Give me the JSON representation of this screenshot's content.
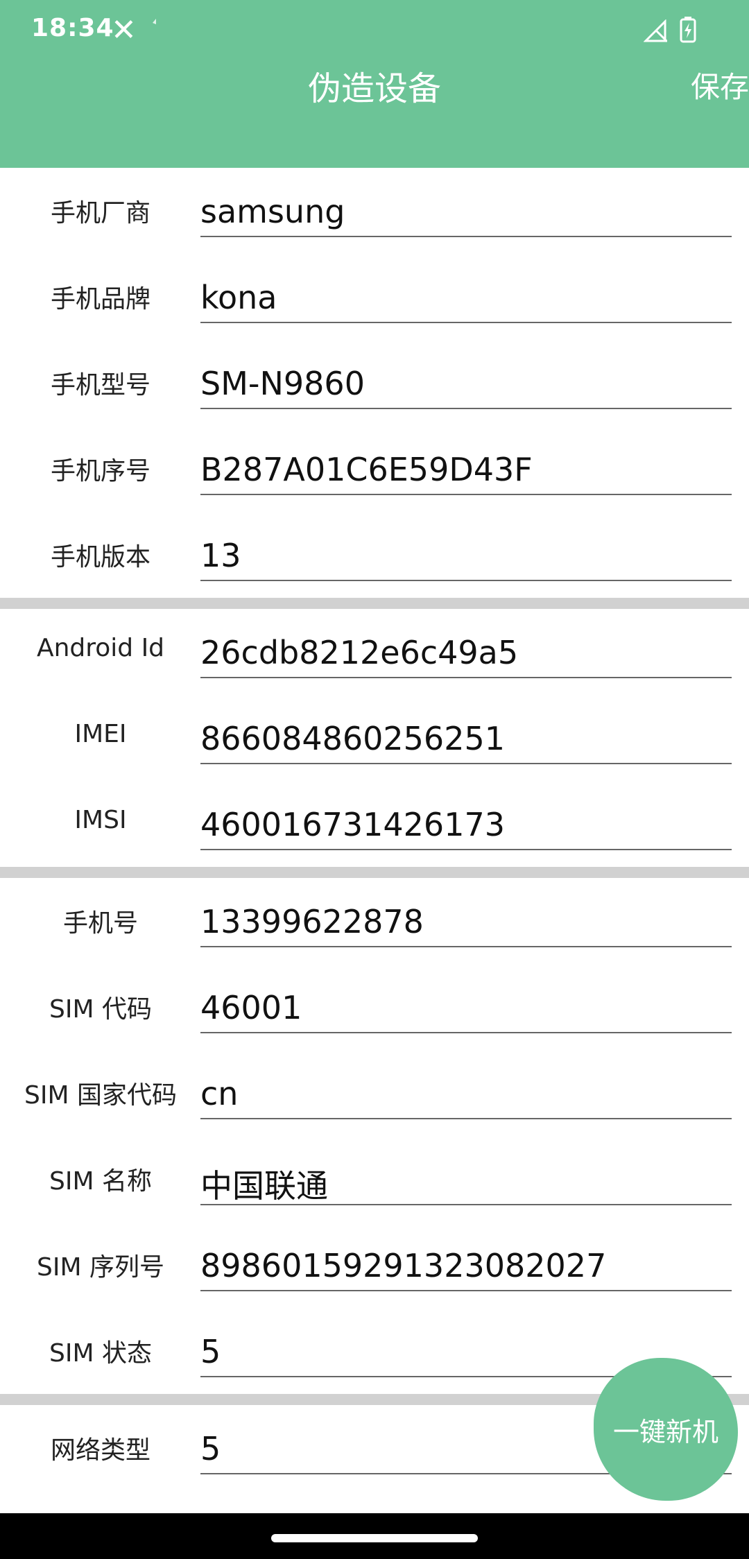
{
  "status_bar": {
    "time": "18:34",
    "icons": [
      "close-icon",
      "notification-dot-icon",
      "signal-off-icon",
      "battery-charging-icon"
    ]
  },
  "app_bar": {
    "title": "伪造设备",
    "save_label": "保存"
  },
  "sections": [
    {
      "fields": [
        {
          "label": "手机厂商",
          "value": "samsung"
        },
        {
          "label": "手机品牌",
          "value": "kona"
        },
        {
          "label": "手机型号",
          "value": "SM-N9860"
        },
        {
          "label": "手机序号",
          "value": "B287A01C6E59D43F"
        },
        {
          "label": "手机版本",
          "value": "13"
        }
      ]
    },
    {
      "fields": [
        {
          "label": "Android Id",
          "value": "26cdb8212e6c49a5"
        },
        {
          "label": "IMEI",
          "value": "866084860256251"
        },
        {
          "label": "IMSI",
          "value": "460016731426173"
        }
      ]
    },
    {
      "fields": [
        {
          "label": "手机号",
          "value": "13399622878"
        },
        {
          "label": "SIM 代码",
          "value": "46001"
        },
        {
          "label": "SIM 国家代码",
          "value": "cn"
        },
        {
          "label": "SIM 名称",
          "value": "中国联通"
        },
        {
          "label": "SIM 序列号",
          "value": "89860159291323082027"
        },
        {
          "label": "SIM 状态",
          "value": "5"
        }
      ]
    },
    {
      "fields": [
        {
          "label": "网络类型",
          "value": "5"
        }
      ]
    }
  ],
  "fab": {
    "label": "一键新机"
  },
  "colors": {
    "accent": "#6cc497",
    "separator": "#d1d1d1",
    "navbar": "#000000"
  }
}
